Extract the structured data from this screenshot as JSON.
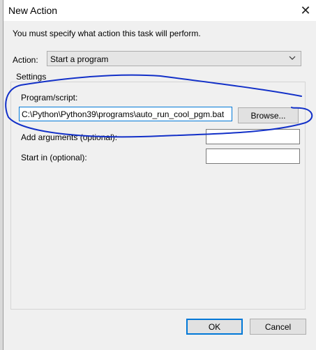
{
  "window": {
    "title": "New Action",
    "close_glyph": "✕"
  },
  "instruction": "You must specify what action this task will perform.",
  "action": {
    "label": "Action:",
    "selected": "Start a program",
    "chevron_icon": "chevron-down-icon"
  },
  "settings": {
    "title": "Settings",
    "program_label": "Program/script:",
    "program_value": "C:\\Python\\Python39\\programs\\auto_run_cool_pgm.bat",
    "browse_label": "Browse...",
    "args_label": "Add arguments (optional):",
    "args_value": "",
    "start_label": "Start in (optional):",
    "start_value": ""
  },
  "buttons": {
    "ok": "OK",
    "cancel": "Cancel"
  },
  "colors": {
    "accent": "#0078d7",
    "annotation": "#1230c8",
    "dialog_bg": "#f0f0f0"
  }
}
